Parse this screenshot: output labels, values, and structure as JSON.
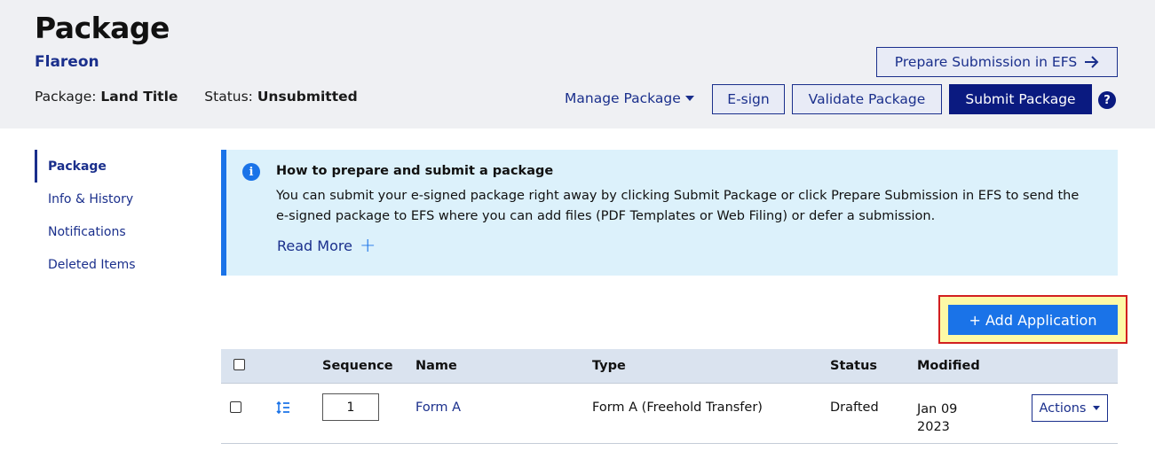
{
  "header": {
    "title": "Package",
    "subtitle": "Flareon",
    "package_label": "Package:",
    "package_value": "Land Title",
    "status_label": "Status:",
    "status_value": "Unsubmitted",
    "prepare_button": "Prepare Submission in EFS",
    "manage_label": "Manage Package",
    "esign_button": "E-sign",
    "validate_button": "Validate Package",
    "submit_button": "Submit Package",
    "help_glyph": "?"
  },
  "sidebar": {
    "items": [
      {
        "label": "Package",
        "active": true
      },
      {
        "label": "Info & History"
      },
      {
        "label": "Notifications"
      },
      {
        "label": "Deleted Items"
      }
    ]
  },
  "info": {
    "icon_glyph": "i",
    "title": "How to prepare and submit a package",
    "body": "You can submit your e-signed package right away by clicking Submit Package or click Prepare Submission in EFS to send the e-signed package to EFS where you can add files (PDF Templates or Web Filing) or defer a submission.",
    "read_more": "Read More",
    "read_more_icon": "+"
  },
  "add_button": "+ Add Application",
  "table": {
    "headers": {
      "sequence": "Sequence",
      "name": "Name",
      "type": "Type",
      "status": "Status",
      "modified": "Modified"
    },
    "rows": [
      {
        "sequence": "1",
        "name": "Form A",
        "type": "Form A (Freehold Transfer)",
        "status": "Drafted",
        "modified_line1": "Jan 09",
        "modified_line2": "2023",
        "actions": "Actions"
      }
    ]
  },
  "colors": {
    "navy": "#0a1a80",
    "link": "#1a2f8c",
    "accent_blue": "#1a73e8",
    "header_bg": "#eff0f3",
    "info_bg": "#dcf1fb",
    "highlight_fill": "#fdf9a6",
    "highlight_border": "#d21f1f"
  },
  "icons": {
    "prepare": "arrow-right-icon",
    "help": "help-circle-icon",
    "info": "info-circle-icon",
    "reorder": "reorder-icon",
    "caret": "caret-down-icon"
  }
}
